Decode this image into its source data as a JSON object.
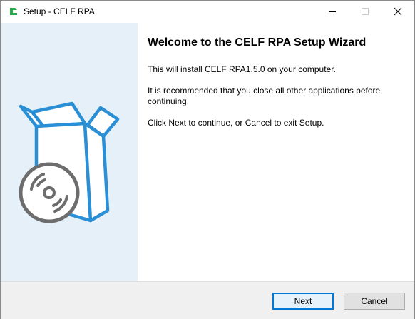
{
  "window": {
    "title": "Setup - CELF RPA",
    "controls": {
      "minimize": "minimize-icon",
      "maximize": "maximize-icon",
      "close": "close-icon"
    }
  },
  "wizard": {
    "heading": "Welcome to the CELF RPA Setup Wizard",
    "paragraphs": [
      "This will install CELF RPA1.5.0 on your computer.",
      "It is recommended that you close all other applications before continuing.",
      "Click Next to continue, or Cancel to exit Setup."
    ]
  },
  "buttons": {
    "next_label": "Next",
    "cancel_label": "Cancel"
  },
  "colors": {
    "accent": "#0078d7",
    "sidebar_bg": "#e5f0f8",
    "box_blue": "#2b8fd6",
    "disc_gray": "#6d6d6d"
  }
}
